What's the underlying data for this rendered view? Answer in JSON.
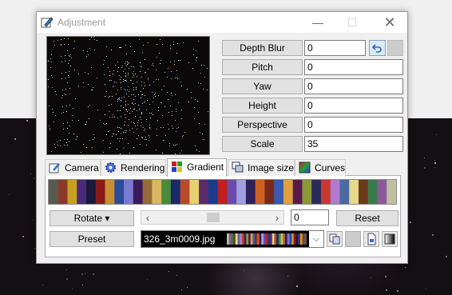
{
  "window": {
    "title": "Adjustment"
  },
  "properties": [
    {
      "label": "Depth Blur",
      "value": "0"
    },
    {
      "label": "Pitch",
      "value": "0"
    },
    {
      "label": "Yaw",
      "value": "0"
    },
    {
      "label": "Height",
      "value": "0"
    },
    {
      "label": "Perspective",
      "value": "0"
    },
    {
      "label": "Scale",
      "value": "35"
    }
  ],
  "tabs": [
    {
      "label": "Camera",
      "icon": "camera-icon"
    },
    {
      "label": "Rendering",
      "icon": "gear-icon"
    },
    {
      "label": "Gradient",
      "icon": "gradient-icon",
      "active": true
    },
    {
      "label": "Image size",
      "icon": "image-size-icon"
    },
    {
      "label": "Curves",
      "icon": "curves-icon"
    }
  ],
  "gradient": {
    "rotate_label": "Rotate ▾",
    "reset_label": "Reset",
    "preset_label": "Preset",
    "rotate_value": "0",
    "preset_file": "326_3m0009.jpg",
    "colors": [
      "#5a5a52",
      "#8a3a2a",
      "#c8a020",
      "#4a2a7a",
      "#1a1a3a",
      "#8a1a1a",
      "#c89030",
      "#2a4a9a",
      "#7a7ad0",
      "#3a1a5a",
      "#9a6a3a",
      "#d8b860",
      "#4a8a3a",
      "#1a2a6a",
      "#b84a2a",
      "#e8d070",
      "#5a2a6a",
      "#1a3a8a",
      "#c02020",
      "#6a4aaa",
      "#a0a0e0",
      "#30205a",
      "#d06020",
      "#7a2a1a",
      "#3a5ab0",
      "#e0a040",
      "#5a1a4a",
      "#8a9a3a",
      "#2a2a5a",
      "#c83a30",
      "#b07ad0",
      "#4a6aa0",
      "#e8d88a",
      "#6a3a1a",
      "#3a7a4a",
      "#8a5a9a",
      "#c0c0a0"
    ]
  }
}
